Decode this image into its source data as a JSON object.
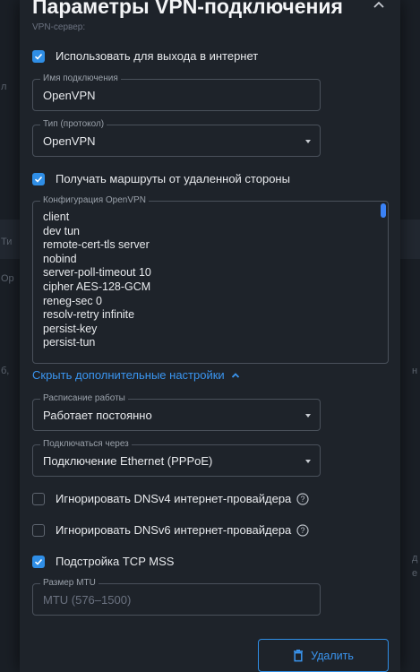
{
  "modal": {
    "title": "Параметры VPN-подключения",
    "subtitle_ghost": "VPN-сервер:"
  },
  "use_for_internet": {
    "label": "Использовать для выхода в интернет",
    "checked": true
  },
  "connection_name": {
    "label": "Имя подключения",
    "value": "OpenVPN"
  },
  "protocol": {
    "label": "Тип (протокол)",
    "value": "OpenVPN"
  },
  "receive_routes": {
    "label": "Получать маршруты от удаленной стороны",
    "checked": true
  },
  "openvpn_config": {
    "label": "Конфигурация OpenVPN",
    "lines": [
      "client",
      "dev tun",
      "remote-cert-tls server",
      "nobind",
      "server-poll-timeout 10",
      "cipher AES-128-GCM",
      "reneg-sec 0",
      "resolv-retry infinite",
      "persist-key",
      "persist-tun"
    ]
  },
  "advanced_toggle": {
    "label": "Скрыть дополнительные настройки"
  },
  "schedule": {
    "label": "Расписание работы",
    "value": "Работает постоянно"
  },
  "connect_via": {
    "label": "Подключаться через",
    "value": "Подключение Ethernet (PPPoE)"
  },
  "ignore_dns4": {
    "label": "Игнорировать DNSv4 интернет-провайдера",
    "checked": false
  },
  "ignore_dns6": {
    "label": "Игнорировать DNSv6 интернет-провайдера",
    "checked": false
  },
  "tcp_mss": {
    "label": "Подстройка TCP MSS",
    "checked": true
  },
  "mtu": {
    "label": "Размер MTU",
    "placeholder": "MTU (576–1500)"
  },
  "delete_button": {
    "label": "Удалить"
  },
  "background": {
    "left_glyphs": [
      "л",
      "Ти",
      "Ор",
      "б,"
    ],
    "right_glyphs": [
      "н",
      "д",
      "е"
    ]
  },
  "colors": {
    "accent": "#2f8ee6",
    "modal_bg": "#1e232a",
    "page_bg": "#151a21"
  },
  "icons": {
    "close": "chevron-up-icon",
    "help": "question-circle-icon",
    "delete": "trash-icon",
    "check": "check-icon"
  }
}
